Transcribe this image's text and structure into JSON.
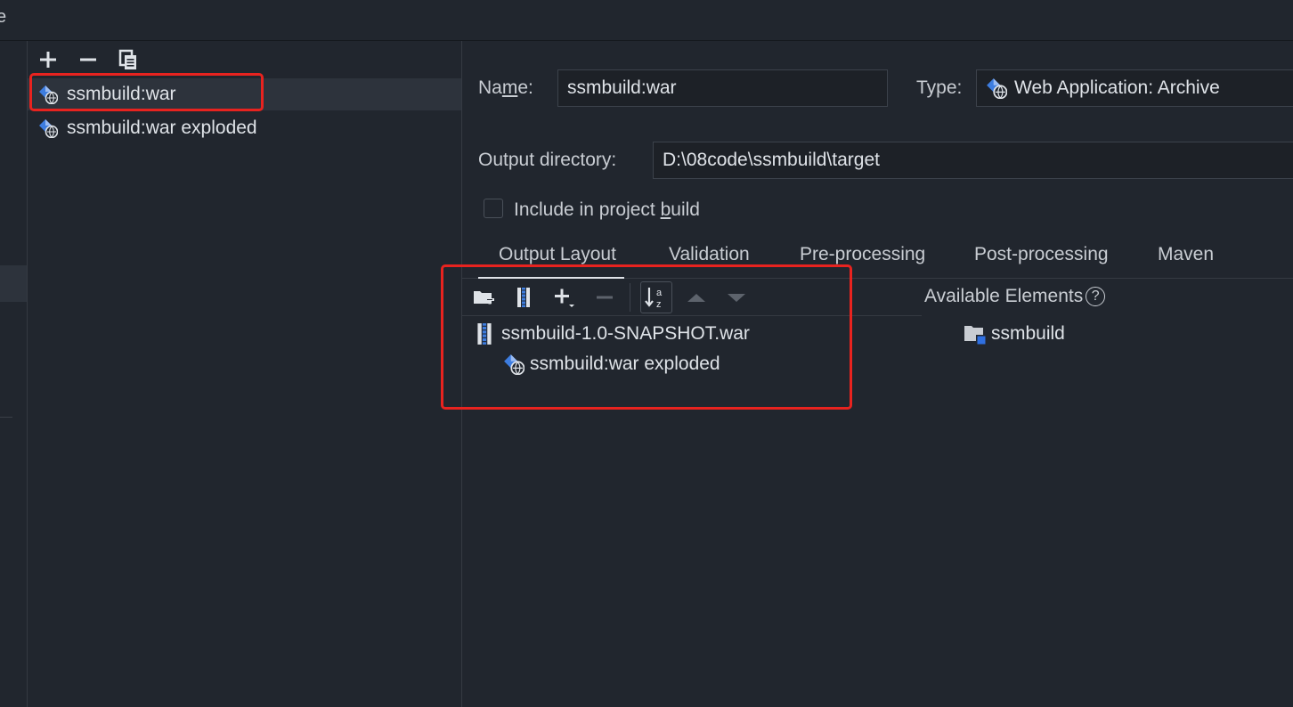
{
  "topbar": {
    "glyph": "e"
  },
  "toolbar": {
    "add_icon": "plus-icon",
    "remove_icon": "minus-icon",
    "copy_icon": "copy-icon"
  },
  "artifacts": [
    {
      "label": "ssmbuild:war",
      "icon": "web-archive-icon",
      "selected": true
    },
    {
      "label": "ssmbuild:war exploded",
      "icon": "web-archive-icon",
      "selected": false
    }
  ],
  "form": {
    "name_label_pre": "Na",
    "name_label_m": "m",
    "name_label_post": "e:",
    "name_value": "ssmbuild:war",
    "type_label": "Type:",
    "type_value": "Web Application: Archive",
    "output_dir_label": "Output directory:",
    "output_dir_value": "D:\\08code\\ssmbuild\\target",
    "include_pre": "Include in project ",
    "include_b": "b",
    "include_post": "uild",
    "include_checked": false
  },
  "tabs": [
    {
      "label": "Output Layout",
      "active": true
    },
    {
      "label": "Validation",
      "active": false
    },
    {
      "label": "Pre-processing",
      "active": false
    },
    {
      "label": "Post-processing",
      "active": false
    },
    {
      "label": "Maven",
      "active": false
    }
  ],
  "layout_toolbar": {
    "create_dir_icon": "folder-plus-icon",
    "create_archive_icon": "archive-icon",
    "add_icon": "plus-dropdown-icon",
    "remove_icon": "minus-icon",
    "sort_icon": "sort-az-icon",
    "move_up_icon": "arrow-up-icon",
    "move_down_icon": "arrow-down-icon"
  },
  "layout_tree": {
    "root": "ssmbuild-1.0-SNAPSHOT.war",
    "child": "ssmbuild:war exploded"
  },
  "available": {
    "title": "Available Elements",
    "help_glyph": "?",
    "items": [
      "ssmbuild"
    ]
  },
  "colors": {
    "background": "#21262e",
    "selection": "#2d333c",
    "highlight_box": "#e8231f",
    "accent_blue": "#3d7de0"
  }
}
